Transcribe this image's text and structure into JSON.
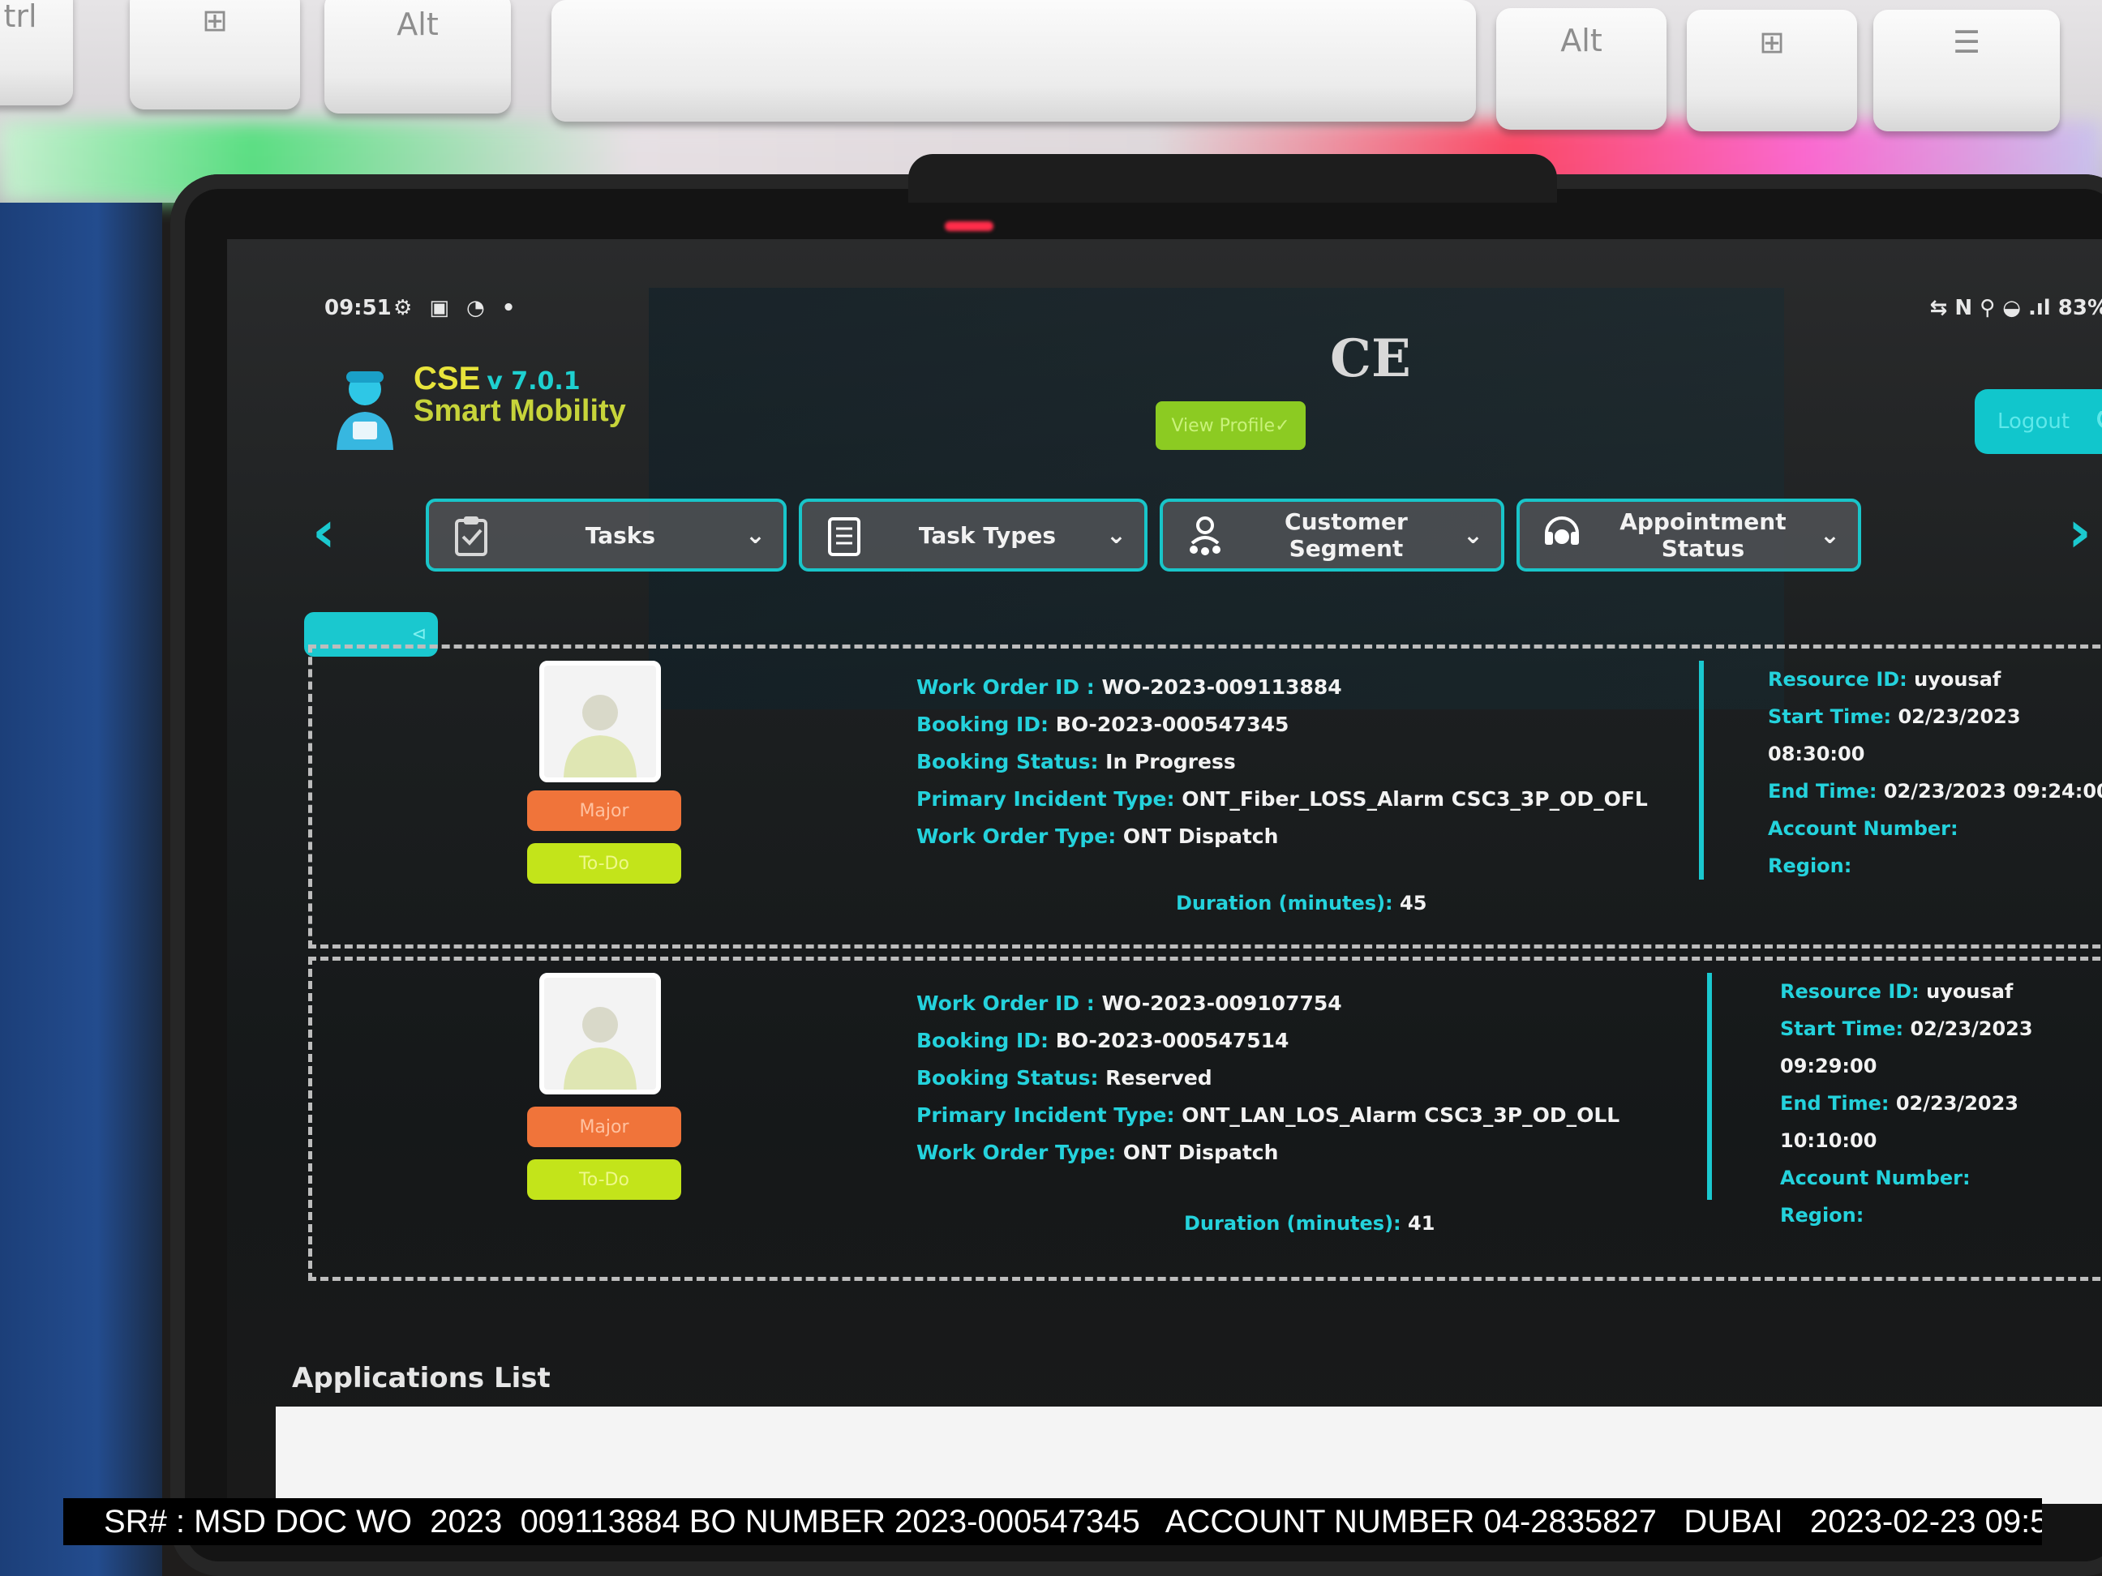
{
  "keyboard": {
    "keys": [
      "trl",
      "⊞",
      "Alt",
      "Alt",
      "⊞",
      "☰"
    ]
  },
  "status_bar": {
    "time": "09:51",
    "icons": "⚙ ▣ ◔ •",
    "battery": "⇆ N ⚲ ◒ .ıl 83%"
  },
  "ce_mark": "CE",
  "app": {
    "name": "CSE",
    "version": "v 7.0.1",
    "subtitle": "Smart Mobility"
  },
  "header": {
    "view_profile": "View Profile✓",
    "logout": "Logout"
  },
  "filters": [
    {
      "label": "Tasks",
      "icon": "clipboard-icon"
    },
    {
      "label": "Task Types",
      "icon": "checklist-icon"
    },
    {
      "label": "Customer Segment",
      "icon": "users-icon"
    },
    {
      "label": "Appointment Status",
      "icon": "support-agent-icon"
    }
  ],
  "back_pill": "⊲",
  "colors": {
    "accent": "#19c5c9",
    "priority": "#f0743a",
    "state": "#c3e41a",
    "view_profile": "#8ccb22"
  },
  "labels": {
    "work_order_id": "Work Order ID : ",
    "booking_id": "Booking ID: ",
    "booking_status": "Booking Status: ",
    "primary_incident_type": "Primary Incident Type: ",
    "work_order_type": "Work Order Type: ",
    "resource_id": "Resource ID: ",
    "start_time": "Start Time: ",
    "end_time": "End Time: ",
    "account_number": "Account Number:",
    "region": "Region:",
    "duration": "Duration (minutes): "
  },
  "work_orders": [
    {
      "priority": "Major",
      "state": "To-Do",
      "work_order_id": "WO-2023-009113884",
      "booking_id": "BO-2023-000547345",
      "booking_status": "In Progress",
      "primary_incident_type": "ONT_Fiber_LOSS_Alarm CSC3_3P_OD_OFL",
      "work_order_type": "ONT Dispatch",
      "resource_id": "uyousaf",
      "start_time": "02/23/2023 08:30:00",
      "end_time": "02/23/2023 09:24:00",
      "account_number": "",
      "region": "",
      "duration": "45"
    },
    {
      "priority": "Major",
      "state": "To-Do",
      "work_order_id": "WO-2023-009107754",
      "booking_id": "BO-2023-000547514",
      "booking_status": "Reserved",
      "primary_incident_type": "ONT_LAN_LOS_Alarm CSC3_3P_OD_OLL",
      "work_order_type": "ONT Dispatch",
      "resource_id": "uyousaf",
      "start_time": "02/23/2023 09:29:00",
      "end_time": "02/23/2023 10:10:00",
      "account_number": "",
      "region": "",
      "duration": "41"
    }
  ],
  "applications_list": "Applications List",
  "overlay_caption": "SR# : MSD DOC WO  2023  009113884 BO NUMBER 2023-000547345   ACCOUNT NUMBER 04-2835827   DUBAI   2023-02-23 09:5"
}
